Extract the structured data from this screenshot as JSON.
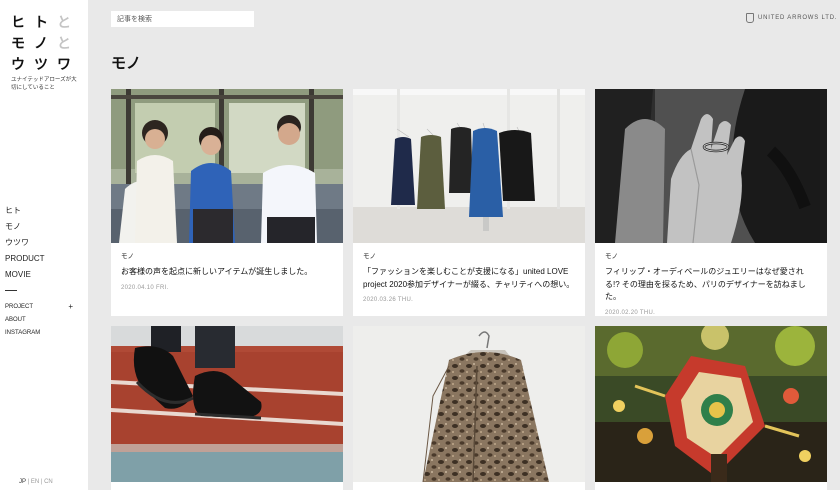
{
  "logo": {
    "rows": [
      [
        "ヒ",
        "ト",
        "と"
      ],
      [
        "モ",
        "ノ",
        "と"
      ],
      [
        "ウ",
        "ツ",
        "ワ"
      ]
    ]
  },
  "tagline": "ユナイテッドアローズが大切にしていること",
  "nav": {
    "main": [
      "ヒト",
      "モノ",
      "ウツワ",
      "PRODUCT",
      "MOVIE"
    ],
    "sub": [
      "PROJECT",
      "ABOUT",
      "INSTAGRAM"
    ],
    "expand_symbol": "+"
  },
  "lang": {
    "jp": "JP",
    "sep": "|",
    "en": "EN",
    "cn": "CN"
  },
  "search": {
    "placeholder": "記事を検索"
  },
  "brand": {
    "name": "UNITED ARROWS LTD."
  },
  "page": {
    "title": "モノ"
  },
  "cards": [
    {
      "category": "モノ",
      "title": "お客様の声を起点に新しいアイテムが誕生しました。",
      "date": "2020.04.10 FRI."
    },
    {
      "category": "モノ",
      "title": "「ファッションを楽しむことが支援になる」united LOVE project 2020参加デザイナーが綴る、チャリティへの想い。",
      "date": "2020.03.26 THU."
    },
    {
      "category": "モノ",
      "title": "フィリップ・オーディベールのジュエリーはなぜ愛される!? その理由を探るため、パリのデザイナーを訪ねました。",
      "date": "2020.02.20 THU."
    },
    {
      "category": "",
      "title": "",
      "date": ""
    },
    {
      "category": "",
      "title": "",
      "date": ""
    },
    {
      "category": "",
      "title": "",
      "date": ""
    }
  ]
}
